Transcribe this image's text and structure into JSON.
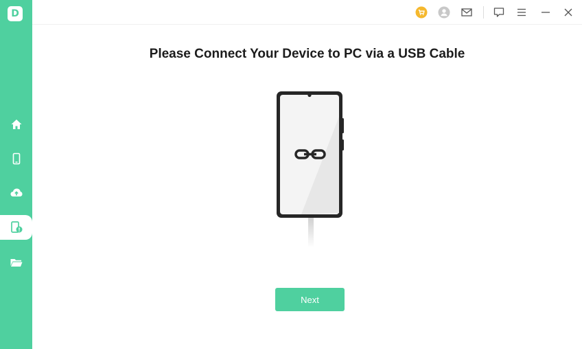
{
  "app": {
    "logo_letter": "D"
  },
  "sidebar": {
    "items": [
      {
        "icon": "home-icon",
        "active": false
      },
      {
        "icon": "phone-icon",
        "active": false
      },
      {
        "icon": "cloud-upload-icon",
        "active": false
      },
      {
        "icon": "phone-alert-icon",
        "active": true
      },
      {
        "icon": "folder-icon",
        "active": false
      }
    ]
  },
  "topbar": {
    "icons": [
      "cart-icon",
      "user-icon",
      "mail-icon",
      "feedback-icon",
      "menu-icon",
      "minimize-icon",
      "close-icon"
    ]
  },
  "main": {
    "title": "Please Connect Your Device to PC via a USB Cable",
    "next_label": "Next"
  },
  "colors": {
    "accent": "#4fd09f",
    "cart_badge": "#f5b82e",
    "title_text": "#1c1c1c"
  }
}
